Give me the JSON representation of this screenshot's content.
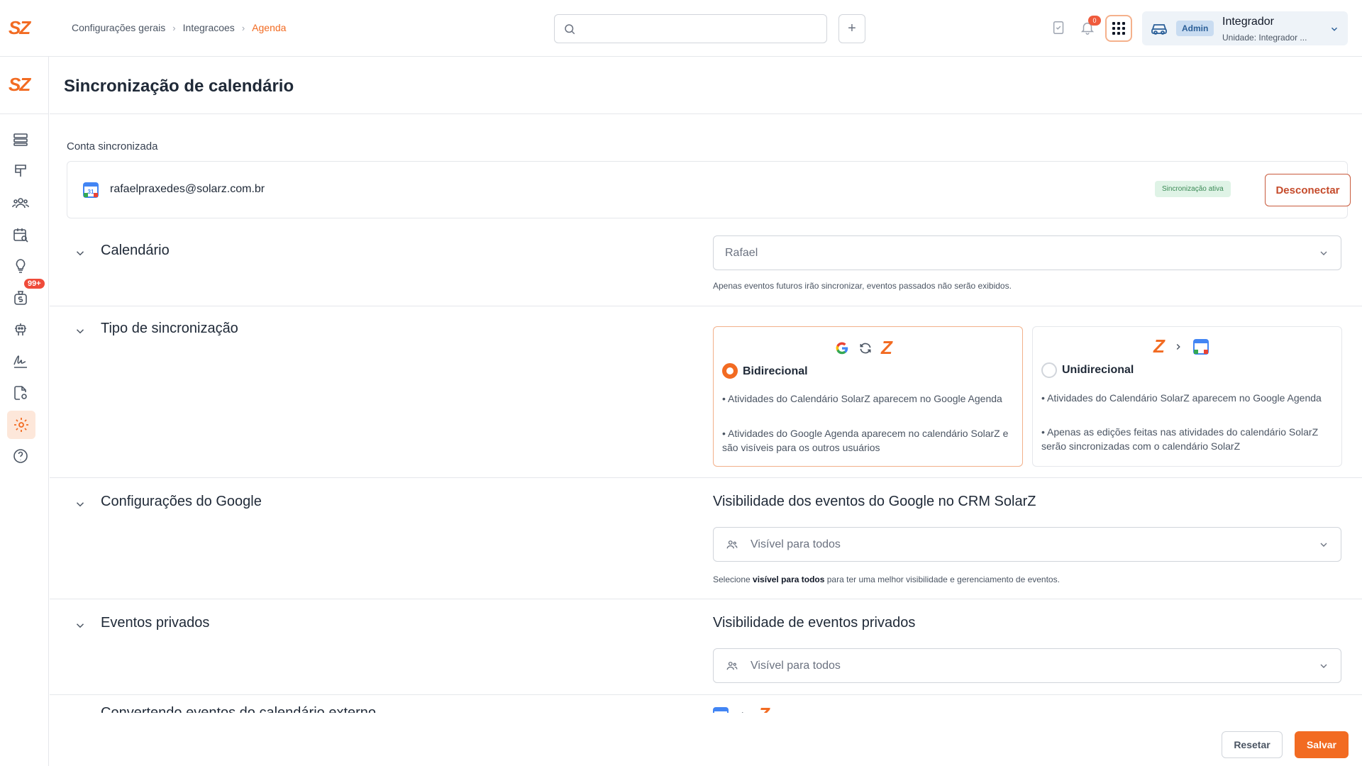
{
  "brand": {
    "logo": "SZ",
    "accent": "#f26b22"
  },
  "breadcrumb": {
    "items": [
      "Configurações gerais",
      "Integracoes",
      "Agenda"
    ]
  },
  "search": {
    "placeholder": ""
  },
  "topbar": {
    "add_label": "+",
    "notification_count": "0",
    "user": {
      "role_badge": "Admin",
      "name": "Integrador",
      "unit": "Unidade: Integrador ..."
    }
  },
  "sidebar": {
    "badge": "99+",
    "items": [
      "list-icon",
      "signpost-icon",
      "users-icon",
      "calendar-search-icon",
      "lightbulb-icon",
      "money-bag-icon",
      "robot-icon",
      "signature-icon",
      "document-settings-icon",
      "gear-icon",
      "help-icon"
    ],
    "active": "gear-icon"
  },
  "page": {
    "title": "Sincronização de calendário"
  },
  "account": {
    "label": "Conta sincronizada",
    "email": "rafaelpraxedes@solarz.com.br",
    "status": "Sincronização ativa",
    "disconnect_label": "Desconectar"
  },
  "sections": {
    "calendar": {
      "title": "Calendário",
      "selected": "Rafael",
      "hint": "Apenas eventos futuros irão sincronizar, eventos passados não serão exibidos."
    },
    "sync_type": {
      "title": "Tipo de sincronização",
      "options": [
        {
          "label": "Bidirecional",
          "selected": true,
          "bullets": [
            "• Atividades do Calendário SolarZ aparecem no Google Agenda",
            "• Atividades do Google Agenda aparecem no calendário SolarZ e são visíveis para os outros usuários"
          ]
        },
        {
          "label": "Unidirecional",
          "selected": false,
          "bullets": [
            "• Atividades do Calendário SolarZ aparecem no Google Agenda",
            "• Apenas as edições feitas nas atividades do calendário SolarZ serão sincronizadas com o calendário SolarZ"
          ]
        }
      ]
    },
    "google": {
      "title": "Configurações do Google",
      "right_title": "Visibilidade dos eventos do Google no CRM SolarZ",
      "selected": "Visível para todos",
      "hint_prefix": "Selecione ",
      "hint_bold": "visível para todos",
      "hint_suffix": " para ter uma melhor visibilidade e gerenciamento de eventos."
    },
    "private": {
      "title": "Eventos privados",
      "right_title": "Visibilidade de eventos privados",
      "selected": "Visível para todos"
    },
    "converting": {
      "title": "Convertendo eventos do calendário externo"
    }
  },
  "footer": {
    "reset_label": "Resetar",
    "save_label": "Salvar"
  }
}
